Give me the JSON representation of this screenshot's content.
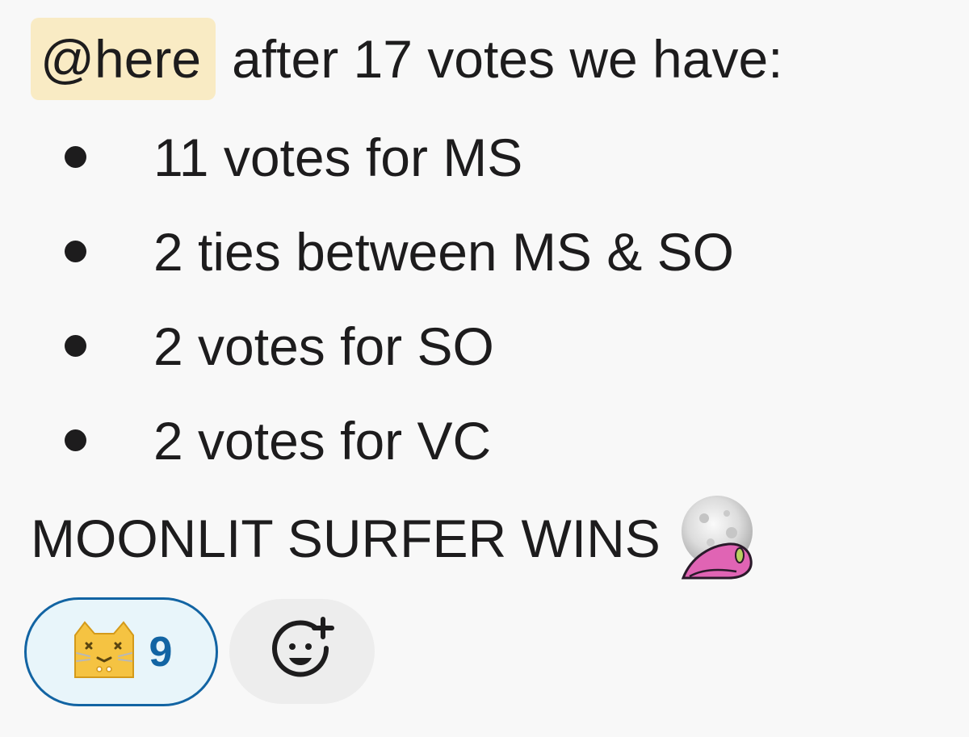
{
  "message": {
    "mention": "@here",
    "intro": "after 17 votes we have:",
    "items": [
      "11 votes for MS",
      "2 ties between MS & SO",
      "2 votes for SO",
      "2 votes for VC"
    ],
    "conclusion": "MOONLIT SURFER WINS",
    "conclusion_emoji": "moonlit-surfer-emoji"
  },
  "reactions": [
    {
      "emoji": "cat-face-emoji",
      "count": "9",
      "selected": true
    }
  ],
  "add_reaction": {
    "icon": "add-reaction-smiley-icon"
  },
  "colors": {
    "mention_bg": "#f9ebc4",
    "reaction_border": "#1264a3",
    "reaction_bg": "#e8f5fa",
    "text": "#1d1c1d",
    "background": "#f8f8f8"
  }
}
